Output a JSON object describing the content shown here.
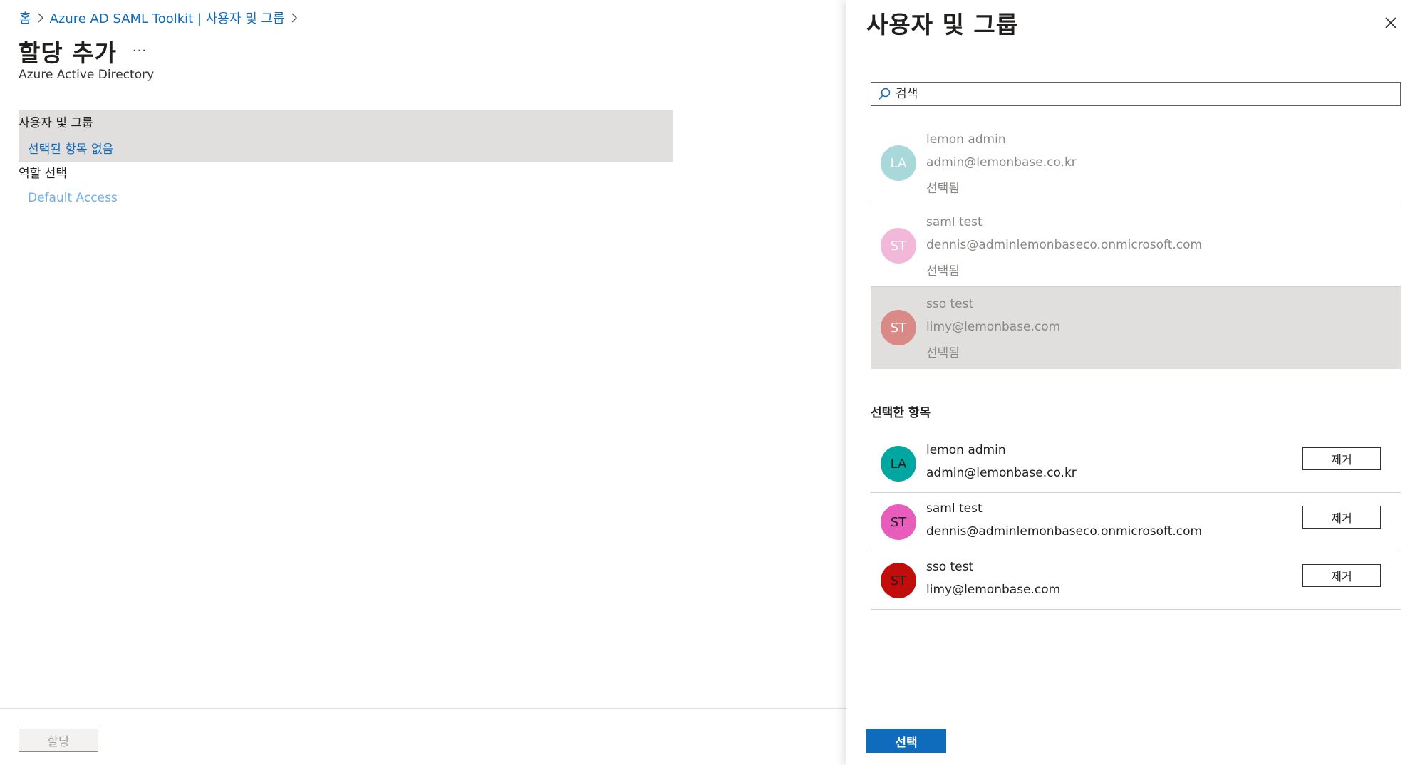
{
  "breadcrumb": [
    {
      "label": "홈"
    },
    {
      "label": "Azure AD SAML Toolkit | 사용자 및 그룹"
    }
  ],
  "left": {
    "title": "할당 추가",
    "more_label": "...",
    "subtitle": "Azure Active Directory",
    "users_section": {
      "label": "사용자 및 그룹",
      "link": "선택된 항목 없음"
    },
    "role_section": {
      "label": "역할 선택",
      "link": "Default Access"
    },
    "assign_button": "할당"
  },
  "panel": {
    "title": "사용자 및 그룹",
    "search": {
      "placeholder": "검색",
      "value": ""
    },
    "results": [
      {
        "initials": "LA",
        "name": "lemon admin",
        "email": "admin@lemonbase.co.kr",
        "status": "선택됨",
        "color": "#a8d8da"
      },
      {
        "initials": "ST",
        "name": "saml test",
        "email": "dennis@adminlemonbaseco.onmicrosoft.com",
        "status": "선택됨",
        "color": "#f2b8da"
      },
      {
        "initials": "ST",
        "name": "sso test",
        "email": "limy@lemonbase.com",
        "status": "선택됨",
        "color": "#d98a86"
      }
    ],
    "selected_header": "선택한 항목",
    "selected": [
      {
        "initials": "LA",
        "name": "lemon admin",
        "email": "admin@lemonbase.co.kr",
        "remove_label": "제거",
        "color": "#00a7a0"
      },
      {
        "initials": "ST",
        "name": "saml test",
        "email": "dennis@adminlemonbaseco.onmicrosoft.com",
        "remove_label": "제거",
        "color": "#e85dbb"
      },
      {
        "initials": "ST",
        "name": "sso test",
        "email": "limy@lemonbase.com",
        "remove_label": "제거",
        "color": "#c20d0d"
      }
    ],
    "select_button": "선택"
  },
  "colors": {
    "accent": "#0f6cbd",
    "selected_row": "#e1dfdd"
  }
}
